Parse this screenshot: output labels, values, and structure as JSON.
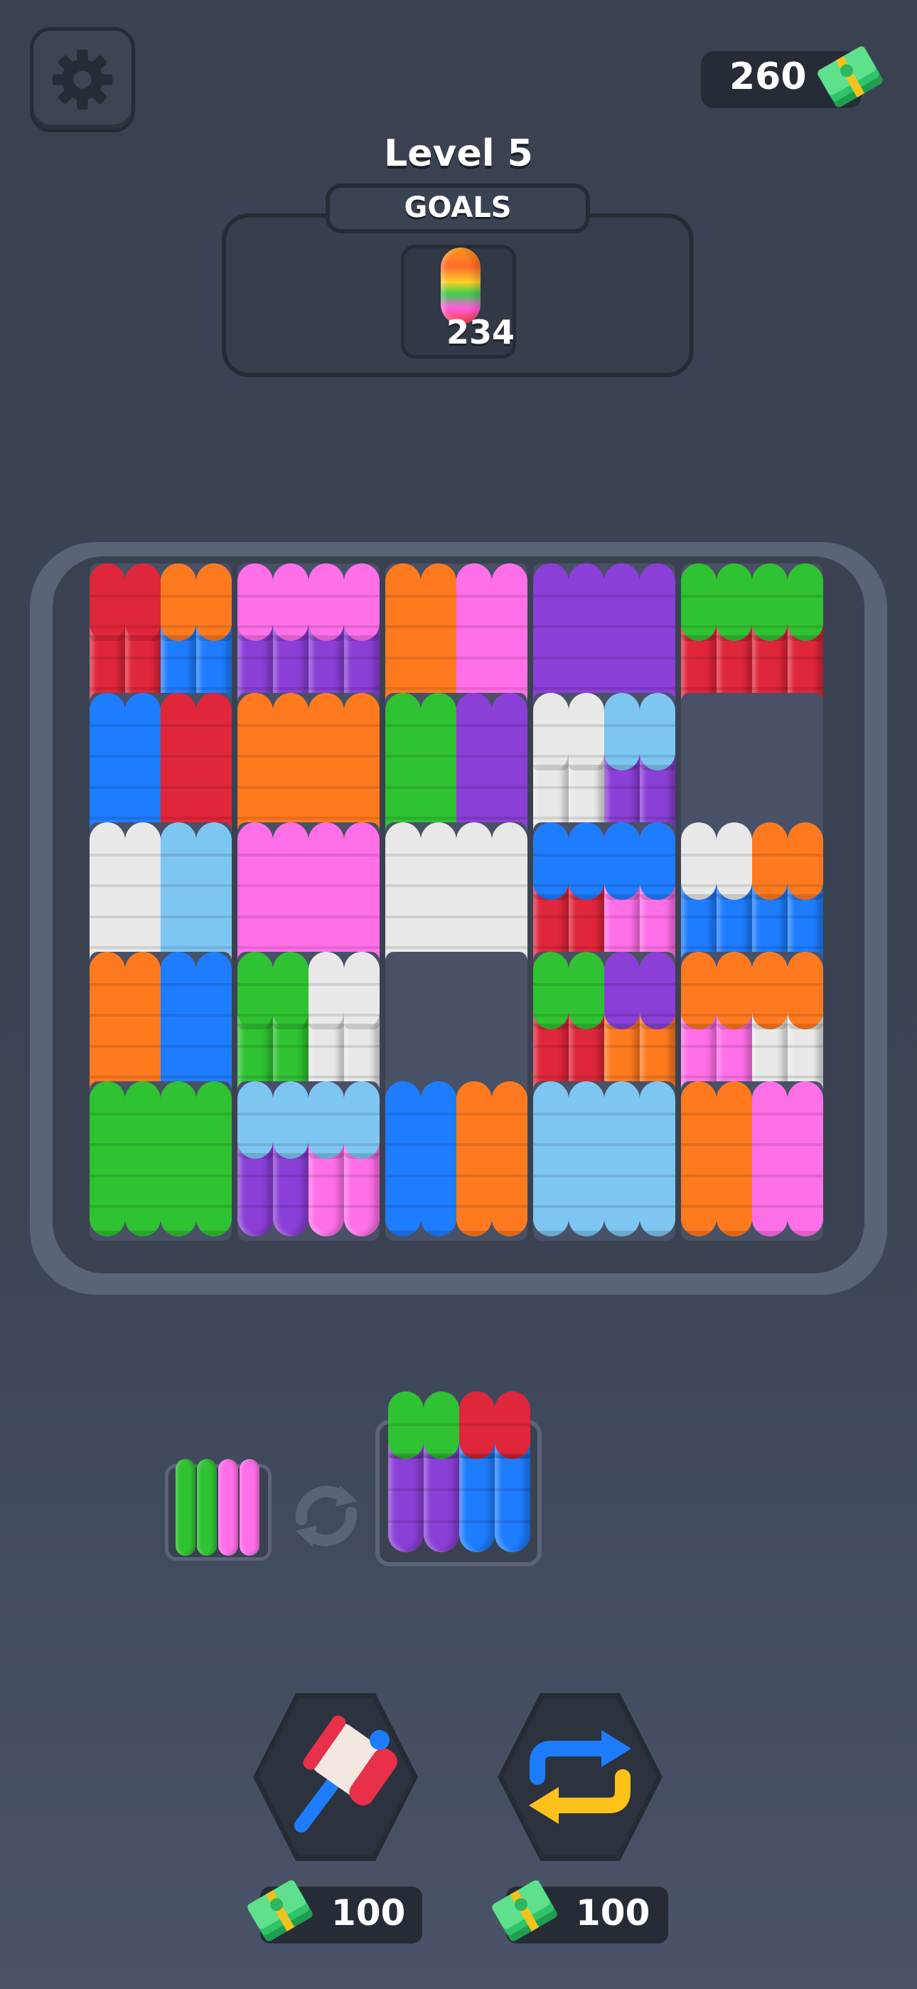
{
  "header": {
    "money": "260",
    "level_title": "Level 5",
    "goals_label": "GOALS",
    "goal_count": "234"
  },
  "icons": {
    "settings": "gear-icon",
    "money": "cash-stack-icon",
    "swap": "swap-cycle-icon",
    "hammer": "hammer-icon",
    "shuffle": "shuffle-arrows-icon"
  },
  "colors": {
    "red": "#e0263a",
    "orange": "#ff7a1f",
    "pink": "#ff6fe8",
    "purple": "#8a3fd6",
    "green": "#2fc232",
    "blue": "#1e7dff",
    "lightblue": "#7ec6f2",
    "white": "#e8e8e8"
  },
  "board": {
    "columns": 5,
    "rows": 5,
    "cells": [
      [
        [
          "red",
          "red"
        ],
        [
          "orange",
          "orange"
        ]
      ],
      [
        [
          "pink",
          "pink"
        ],
        [
          "pink",
          "pink"
        ]
      ],
      [
        [
          "orange",
          "orange"
        ],
        [
          "pink",
          "pink"
        ]
      ],
      [
        [
          "purple",
          "purple"
        ],
        [
          "purple",
          "purple"
        ]
      ],
      [
        [
          "green",
          "green"
        ],
        [
          "green",
          "green"
        ]
      ],
      [
        [
          "blue",
          "blue"
        ],
        [
          "red",
          "red"
        ]
      ],
      [
        [
          "orange",
          "orange"
        ],
        [
          "orange",
          "orange"
        ]
      ],
      [
        [
          "green",
          "green"
        ],
        [
          "purple",
          "purple"
        ]
      ],
      [
        [
          "white",
          "white"
        ],
        [
          "lightblue",
          "lightblue"
        ]
      ],
      null,
      [
        [
          "white",
          "white"
        ],
        [
          "lightblue",
          "lightblue"
        ]
      ],
      [
        [
          "pink",
          "pink"
        ],
        [
          "pink",
          "pink"
        ]
      ],
      [
        [
          "white",
          "white"
        ],
        [
          "white",
          "white"
        ]
      ],
      [
        [
          "blue",
          "blue"
        ],
        [
          "blue",
          "blue"
        ]
      ],
      [
        [
          "white",
          "white"
        ],
        [
          "orange",
          "orange"
        ]
      ],
      [
        [
          "orange",
          "orange"
        ],
        [
          "blue",
          "blue"
        ]
      ],
      [
        [
          "green",
          "green"
        ],
        [
          "white",
          "white"
        ]
      ],
      null,
      [
        [
          "green",
          "green"
        ],
        [
          "orange",
          "orange"
        ]
      ],
      [
        [
          "orange",
          "orange"
        ],
        [
          "orange",
          "orange"
        ]
      ],
      [
        [
          "green",
          "green"
        ],
        [
          "green",
          "green"
        ]
      ],
      [
        [
          "lightblue",
          "lightblue"
        ],
        [
          "lightblue",
          "lightblue"
        ]
      ],
      [
        [
          "blue",
          "blue"
        ],
        [
          "orange",
          "orange"
        ]
      ],
      [
        [
          "lightblue",
          "lightblue"
        ],
        [
          "lightblue",
          "lightblue"
        ]
      ],
      [
        [
          "orange",
          "orange"
        ],
        [
          "pink",
          "pink"
        ]
      ]
    ],
    "split_cells": {
      "0": {
        "top": [
          "red",
          "red",
          "orange",
          "orange"
        ],
        "bottom": [
          "red",
          "red",
          "blue",
          "blue"
        ]
      },
      "1": {
        "top": [
          "pink",
          "pink",
          "pink",
          "pink"
        ],
        "bottom": [
          "purple",
          "purple",
          "purple",
          "purple"
        ]
      },
      "4": {
        "top": [
          "green",
          "green",
          "green",
          "green"
        ],
        "bottom": [
          "red",
          "red",
          "red",
          "red"
        ]
      },
      "8": {
        "top": [
          "white",
          "white",
          "lightblue",
          "lightblue"
        ],
        "bottom": [
          "white",
          "white",
          "purple",
          "purple"
        ]
      },
      "13": {
        "top": [
          "blue",
          "blue",
          "blue",
          "blue"
        ],
        "bottom": [
          "red",
          "red",
          "pink",
          "pink"
        ]
      },
      "14": {
        "top": [
          "white",
          "white",
          "orange",
          "orange"
        ],
        "bottom": [
          "blue",
          "blue",
          "blue",
          "blue"
        ]
      },
      "16": {
        "top": [
          "green",
          "green",
          "white",
          "white"
        ],
        "bottom": [
          "green",
          "green",
          "white",
          "white"
        ]
      },
      "18": {
        "top": [
          "green",
          "green",
          "purple",
          "purple"
        ],
        "bottom": [
          "red",
          "red",
          "orange",
          "orange"
        ]
      },
      "19": {
        "top": [
          "orange",
          "orange",
          "orange",
          "orange"
        ],
        "bottom": [
          "pink",
          "pink",
          "white",
          "white"
        ]
      },
      "21": {
        "top": [
          "lightblue",
          "lightblue",
          "lightblue",
          "lightblue"
        ],
        "bottom": [
          "purple",
          "purple",
          "pink",
          "pink"
        ]
      }
    }
  },
  "tray": {
    "small_piece": [
      "green",
      "green",
      "pink",
      "pink"
    ],
    "big_piece": {
      "top": [
        "green",
        "green",
        "red",
        "red"
      ],
      "bottom": [
        "purple",
        "purple",
        "blue",
        "blue"
      ]
    }
  },
  "powerups": [
    {
      "name": "hammer",
      "price": "100"
    },
    {
      "name": "shuffle",
      "price": "100"
    }
  ]
}
